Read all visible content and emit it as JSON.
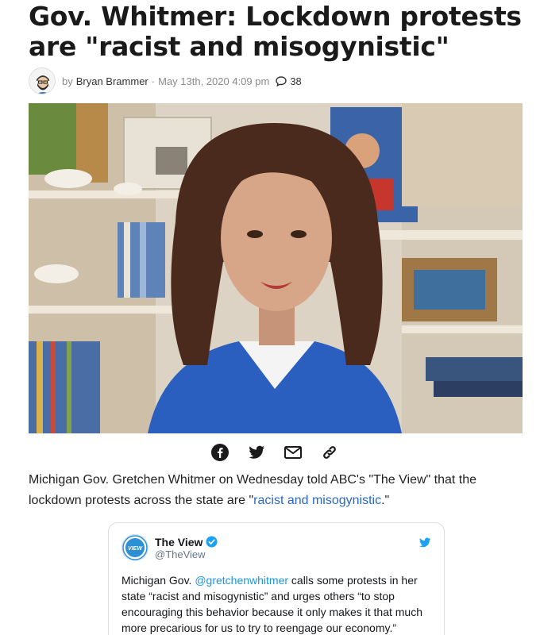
{
  "article": {
    "headline": "Gov. Whitmer: Lockdown protests are \"racist and misogynistic\"",
    "byline_prefix": "by",
    "author": "Bryan Brammer",
    "separator": "·",
    "date": "May 13th, 2020 4:09 pm",
    "comment_count": "38",
    "hero_image": "woman-portrait-video-call",
    "lede_text": "Michigan Gov. Gretchen Whitmer on Wednesday told ABC's \"The View\" that the lockdown protests across the state are \"",
    "lede_link": "racist and misogynistic",
    "lede_end": ".\""
  },
  "share": {
    "icons": [
      "facebook-icon",
      "twitter-icon",
      "email-icon",
      "link-icon"
    ]
  },
  "tweet": {
    "name": "The View",
    "handle": "@TheView",
    "logo_text": "VIEW",
    "text_before": "Michigan Gov. ",
    "mention": "@gretchenwhitmer",
    "text_after": " calls some protests in her state “racist and misogynistic” and urges others “to stop encouraging this behavior because it only makes it that much more precarious for us to try to reengage our economy.”"
  },
  "colors": {
    "link": "#2a68c2",
    "twitter_blue": "#1da1f2",
    "share_icon": "#1a1a1a"
  }
}
